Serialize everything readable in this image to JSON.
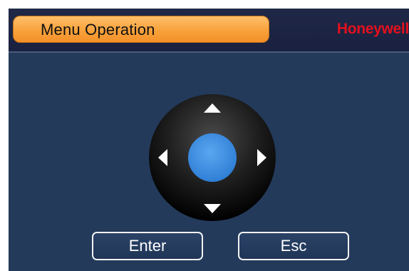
{
  "header": {
    "title": "Menu Operation",
    "brand": "Honeywell"
  },
  "dpad": {
    "up_icon": "arrow-up-icon",
    "down_icon": "arrow-down-icon",
    "left_icon": "arrow-left-icon",
    "right_icon": "arrow-right-icon",
    "center_color": "#3a8ee3"
  },
  "buttons": {
    "enter_label": "Enter",
    "esc_label": "Esc"
  },
  "colors": {
    "background": "#233a5b",
    "title_accent": "#f8a23c",
    "brand": "#e3101f"
  }
}
